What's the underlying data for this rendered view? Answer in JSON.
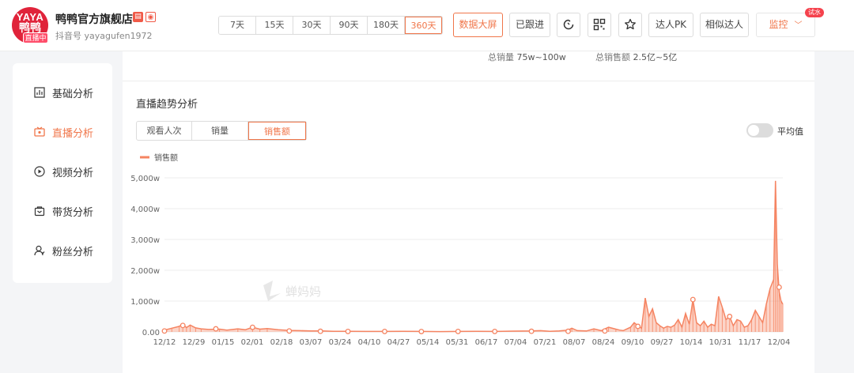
{
  "header": {
    "logo": {
      "line1": "YAYA",
      "line2": "鸭鸭",
      "live_badge": "直播中"
    },
    "shop_name": "鸭鸭官方旗舰店",
    "douyin_id": "抖音号 yayagufen1972",
    "ranges": [
      {
        "label": "7天",
        "active": false
      },
      {
        "label": "15天",
        "active": false
      },
      {
        "label": "30天",
        "active": false
      },
      {
        "label": "90天",
        "active": false
      },
      {
        "label": "180天",
        "active": false
      },
      {
        "label": "360天",
        "active": true
      }
    ],
    "big_screen_label": "数据大屏",
    "followed_label": "已跟进",
    "pk_label": "达人PK",
    "similar_label": "相似达人",
    "monitor_label": "监控",
    "monitor_badge": "试水"
  },
  "sidebar": {
    "items": [
      {
        "label": "基础分析",
        "icon": "bar-chart-icon",
        "active": false
      },
      {
        "label": "直播分析",
        "icon": "live-icon",
        "active": true
      },
      {
        "label": "视频分析",
        "icon": "play-icon",
        "active": false
      },
      {
        "label": "带货分析",
        "icon": "bag-icon",
        "active": false
      },
      {
        "label": "粉丝分析",
        "icon": "user-icon",
        "active": false
      }
    ]
  },
  "summary": {
    "sales_label": "总销量",
    "sales_value": "75w~100w",
    "revenue_label": "总销售额",
    "revenue_value": "2.5亿~5亿"
  },
  "section": {
    "title": "直播趋势分析",
    "tabs": [
      {
        "label": "观看人次",
        "active": false
      },
      {
        "label": "销量",
        "active": false
      },
      {
        "label": "销售额",
        "active": true
      }
    ],
    "average_label": "平均值"
  },
  "watermark": "蝉妈妈",
  "colors": {
    "accent": "#f0764a",
    "series": "#f58462"
  },
  "chart_data": {
    "type": "area",
    "title": "",
    "xlabel": "",
    "ylabel": "",
    "legend": "top-left",
    "grid": true,
    "series": [
      {
        "name": "销售额"
      }
    ],
    "yticks": [
      "0.00",
      "1,000w",
      "2,000w",
      "3,000w",
      "4,000w",
      "5,000w"
    ],
    "ylim": [
      0,
      5000
    ],
    "xticks": [
      "12/12",
      "12/29",
      "01/15",
      "02/01",
      "02/18",
      "03/07",
      "03/24",
      "04/10",
      "04/27",
      "05/14",
      "05/31",
      "06/17",
      "07/04",
      "07/21",
      "08/07",
      "08/24",
      "09/10",
      "09/27",
      "10/14",
      "10/31",
      "11/17",
      "12/04"
    ],
    "points": [
      [
        0,
        60
      ],
      [
        4,
        120
      ],
      [
        8,
        180
      ],
      [
        10,
        250
      ],
      [
        12,
        140
      ],
      [
        14,
        220
      ],
      [
        17,
        130
      ],
      [
        20,
        100
      ],
      [
        24,
        80
      ],
      [
        30,
        90
      ],
      [
        34,
        60
      ],
      [
        40,
        100
      ],
      [
        44,
        70
      ],
      [
        48,
        150
      ],
      [
        52,
        90
      ],
      [
        56,
        110
      ],
      [
        62,
        70
      ],
      [
        68,
        50
      ],
      [
        74,
        40
      ],
      [
        80,
        30
      ],
      [
        86,
        30
      ],
      [
        92,
        20
      ],
      [
        100,
        20
      ],
      [
        110,
        15
      ],
      [
        120,
        15
      ],
      [
        130,
        20
      ],
      [
        140,
        15
      ],
      [
        150,
        10
      ],
      [
        160,
        15
      ],
      [
        170,
        20
      ],
      [
        180,
        15
      ],
      [
        190,
        25
      ],
      [
        200,
        30
      ],
      [
        205,
        40
      ],
      [
        210,
        20
      ],
      [
        215,
        30
      ],
      [
        220,
        60
      ],
      [
        222,
        120
      ],
      [
        225,
        40
      ],
      [
        230,
        30
      ],
      [
        234,
        100
      ],
      [
        238,
        40
      ],
      [
        242,
        150
      ],
      [
        246,
        90
      ],
      [
        248,
        60
      ],
      [
        250,
        40
      ],
      [
        254,
        150
      ],
      [
        256,
        300
      ],
      [
        258,
        200
      ],
      [
        260,
        120
      ],
      [
        262,
        1100
      ],
      [
        264,
        500
      ],
      [
        266,
        750
      ],
      [
        268,
        300
      ],
      [
        270,
        200
      ],
      [
        272,
        120
      ],
      [
        274,
        180
      ],
      [
        276,
        150
      ],
      [
        278,
        220
      ],
      [
        280,
        400
      ],
      [
        282,
        150
      ],
      [
        284,
        600
      ],
      [
        286,
        250
      ],
      [
        288,
        1050
      ],
      [
        290,
        300
      ],
      [
        292,
        200
      ],
      [
        294,
        350
      ],
      [
        296,
        150
      ],
      [
        298,
        250
      ],
      [
        300,
        200
      ],
      [
        302,
        1150
      ],
      [
        304,
        800
      ],
      [
        306,
        400
      ],
      [
        308,
        500
      ],
      [
        310,
        200
      ],
      [
        312,
        400
      ],
      [
        314,
        350
      ],
      [
        316,
        150
      ],
      [
        318,
        200
      ],
      [
        320,
        400
      ],
      [
        322,
        700
      ],
      [
        324,
        500
      ],
      [
        326,
        300
      ],
      [
        328,
        900
      ],
      [
        330,
        1400
      ],
      [
        332,
        1700
      ],
      [
        333,
        4900
      ],
      [
        334,
        2200
      ],
      [
        335,
        1300
      ],
      [
        336,
        1000
      ],
      [
        337,
        900
      ]
    ],
    "markers": [
      [
        0,
        30
      ],
      [
        10,
        210
      ],
      [
        28,
        100
      ],
      [
        48,
        150
      ],
      [
        68,
        30
      ],
      [
        85,
        20
      ],
      [
        100,
        15
      ],
      [
        120,
        15
      ],
      [
        140,
        12
      ],
      [
        160,
        15
      ],
      [
        180,
        15
      ],
      [
        200,
        20
      ],
      [
        220,
        20
      ],
      [
        240,
        30
      ],
      [
        258,
        180
      ],
      [
        288,
        1050
      ],
      [
        308,
        500
      ],
      [
        335,
        1450
      ]
    ],
    "xmax": 337
  }
}
